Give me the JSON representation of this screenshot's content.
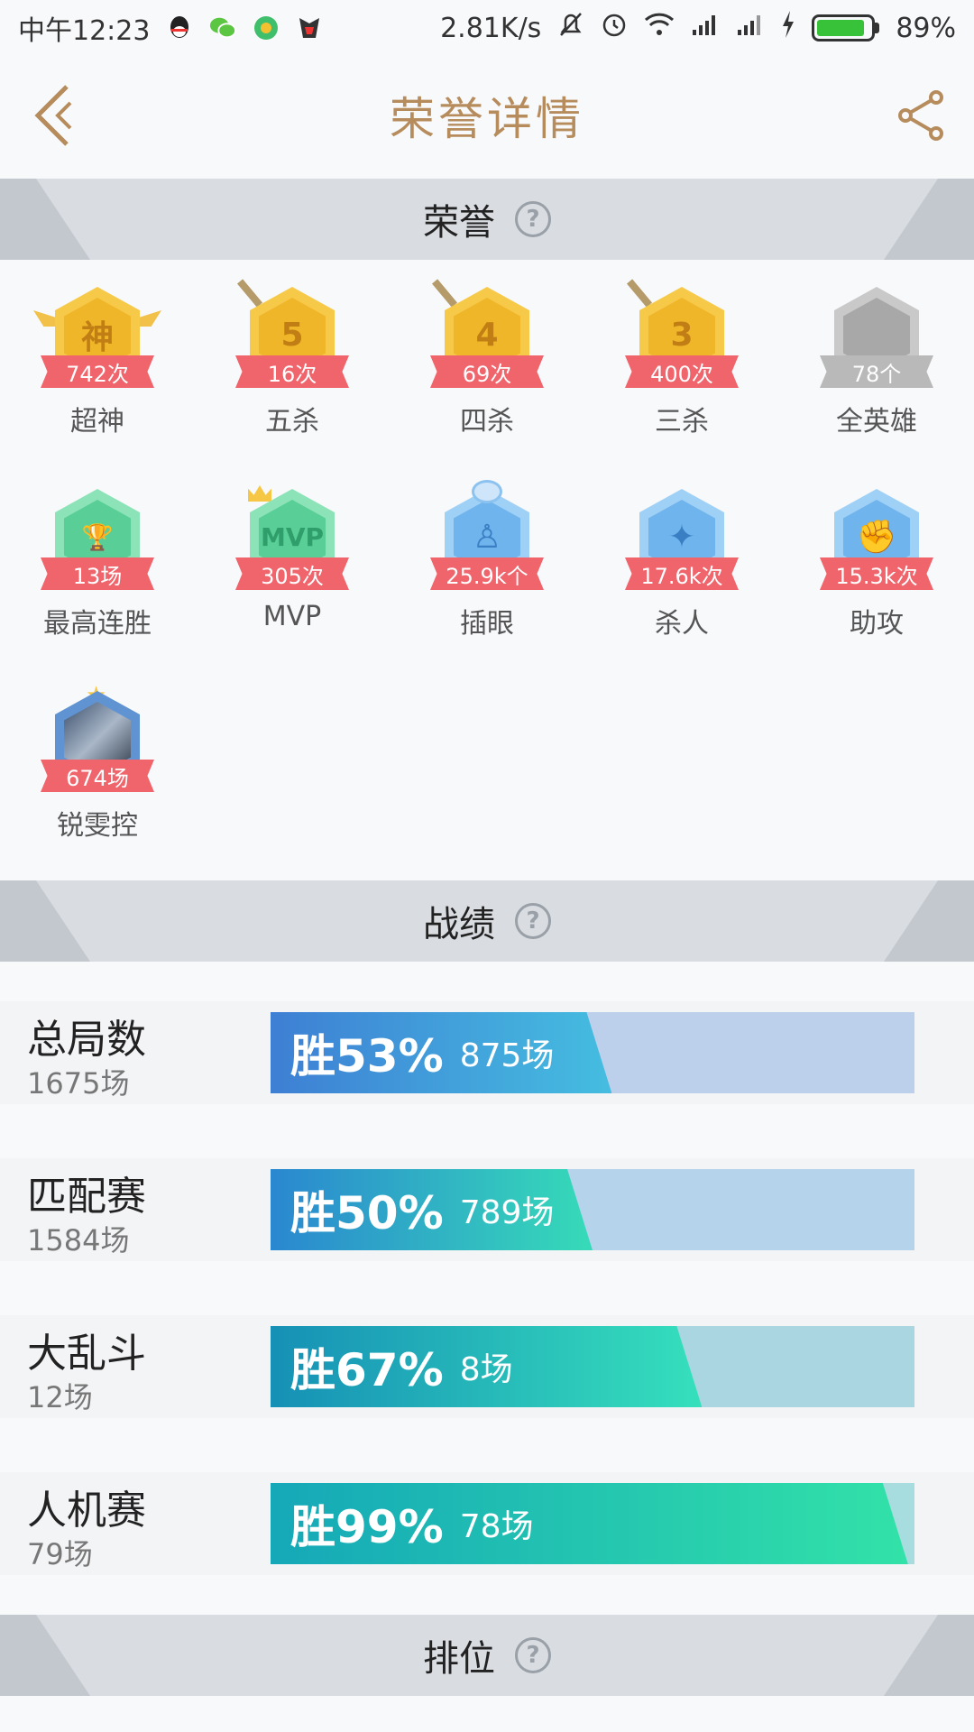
{
  "status_bar": {
    "time": "中午12:23",
    "speed": "2.81K/s",
    "battery": "89%",
    "battery_level": 0.89
  },
  "header": {
    "title": "荣誉详情"
  },
  "sections": {
    "honor": "荣誉",
    "record": "战绩",
    "rank": "排位",
    "help_glyph": "?"
  },
  "honors": [
    {
      "name": "超神",
      "count": "742次",
      "icon": "god-icon",
      "glyph": "神"
    },
    {
      "name": "五杀",
      "count": "16次",
      "icon": "penta-kill-icon",
      "glyph": "5"
    },
    {
      "name": "四杀",
      "count": "69次",
      "icon": "quadra-kill-icon",
      "glyph": "4"
    },
    {
      "name": "三杀",
      "count": "400次",
      "icon": "triple-kill-icon",
      "glyph": "3"
    },
    {
      "name": "全英雄",
      "count": "78个",
      "icon": "all-heroes-icon",
      "glyph": ""
    },
    {
      "name": "最高连胜",
      "count": "13场",
      "icon": "trophy-icon",
      "glyph": "🏆"
    },
    {
      "name": "MVP",
      "count": "305次",
      "icon": "mvp-icon",
      "glyph": "MVP"
    },
    {
      "name": "插眼",
      "count": "25.9k个",
      "icon": "ward-icon",
      "glyph": "♙"
    },
    {
      "name": "杀人",
      "count": "17.6k次",
      "icon": "kill-icon",
      "glyph": "✦"
    },
    {
      "name": "助攻",
      "count": "15.3k次",
      "icon": "assist-icon",
      "glyph": "✊"
    },
    {
      "name": "锐雯控",
      "count": "674场",
      "icon": "hero-portrait-icon",
      "glyph": ""
    }
  ],
  "stats": [
    {
      "name": "总局数",
      "total": "1675场",
      "rate_label": "胜53%",
      "wins": "875场",
      "rate": 0.53,
      "colors": [
        "#3e7fd4",
        "#45bde0"
      ],
      "track": "#bcd0ec"
    },
    {
      "name": "匹配赛",
      "total": "1584场",
      "rate_label": "胜50%",
      "wins": "789场",
      "rate": 0.5,
      "colors": [
        "#2a87d0",
        "#36dbb8"
      ],
      "track": "#b6d3ec"
    },
    {
      "name": "大乱斗",
      "total": "12场",
      "rate_label": "胜67%",
      "wins": "8场",
      "rate": 0.67,
      "colors": [
        "#1690b6",
        "#36e0bc"
      ],
      "track": "#a9d6e0"
    },
    {
      "name": "人机赛",
      "total": "79场",
      "rate_label": "胜99%",
      "wins": "78场",
      "rate": 0.99,
      "colors": [
        "#15a8b8",
        "#32e2a8"
      ],
      "track": "#a8dde0"
    }
  ]
}
